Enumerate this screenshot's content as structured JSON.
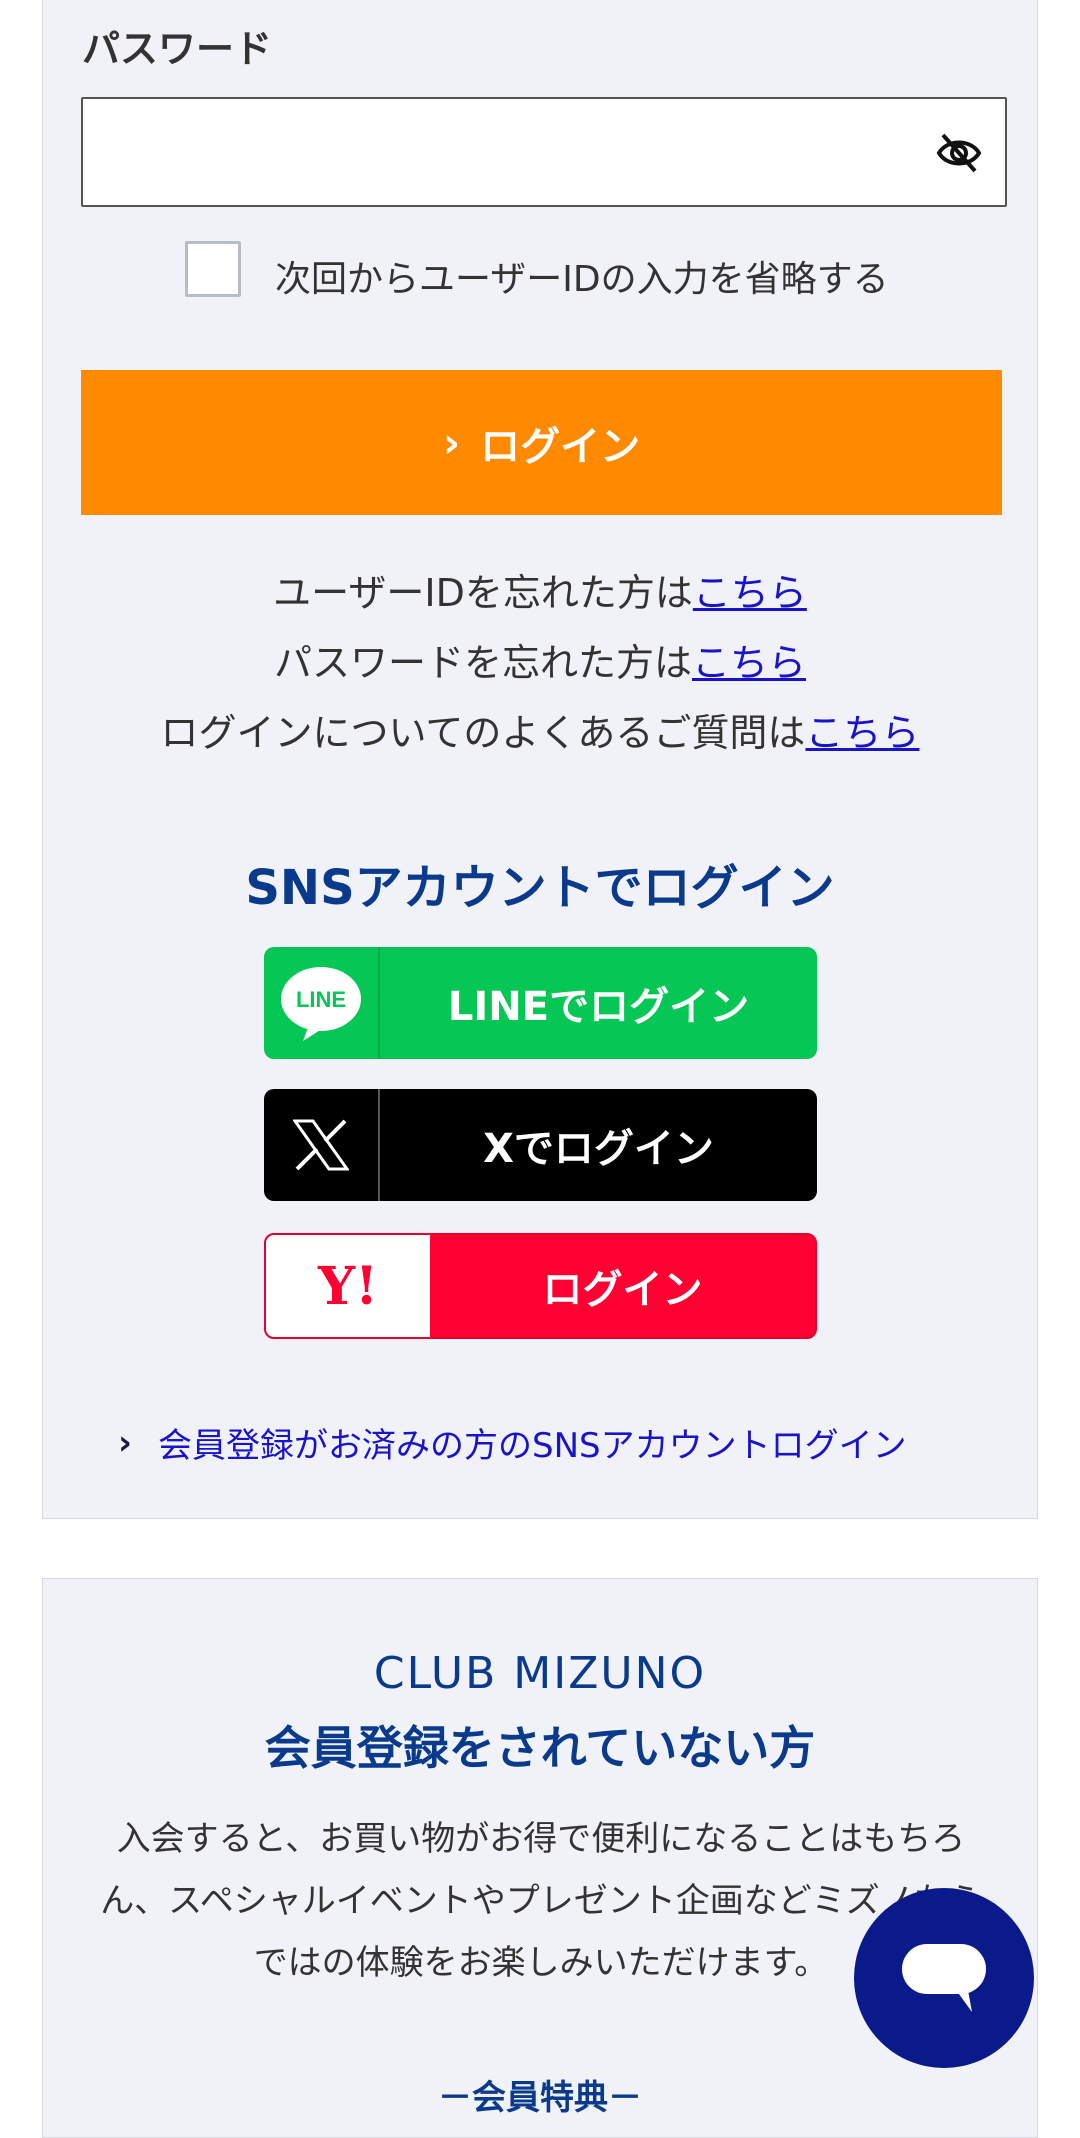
{
  "password": {
    "label": "パスワード",
    "value": "",
    "placeholder": ""
  },
  "remember": {
    "label": "次回からユーザーIDの入力を省略する",
    "checked": false
  },
  "login_button": {
    "label": "ログイン",
    "color": "#ff8a00"
  },
  "help_links": [
    {
      "text": "ユーザーIDを忘れた方は",
      "link": "こちら"
    },
    {
      "text": "パスワードを忘れた方は",
      "link": "こちら"
    },
    {
      "text": "ログインについてのよくあるご質問は",
      "link": "こちら"
    }
  ],
  "sns": {
    "title": "SNSアカウントでログイン",
    "line": {
      "label": "LINEでログイン",
      "icon": "LINE",
      "color": "#06c755"
    },
    "x": {
      "label": "Xでログイン",
      "color": "#000000"
    },
    "yahoo": {
      "label": "ログイン",
      "icon": "Y!",
      "color": "#ff0033"
    },
    "member_link": "会員登録がお済みの方のSNSアカウントログイン"
  },
  "club": {
    "title": "CLUB MIZUNO",
    "subtitle": "会員登録をされていない方",
    "description": "入会すると、お買い物がお得で便利になることはもちろん、スペシャルイベントやプレゼント企画などミズノならではの体験をお楽しみいただけます。",
    "benefit_heading": "－会員特典－"
  },
  "chat": {
    "icon": "chat-bubble-icon",
    "color": "#0a1a8a"
  }
}
